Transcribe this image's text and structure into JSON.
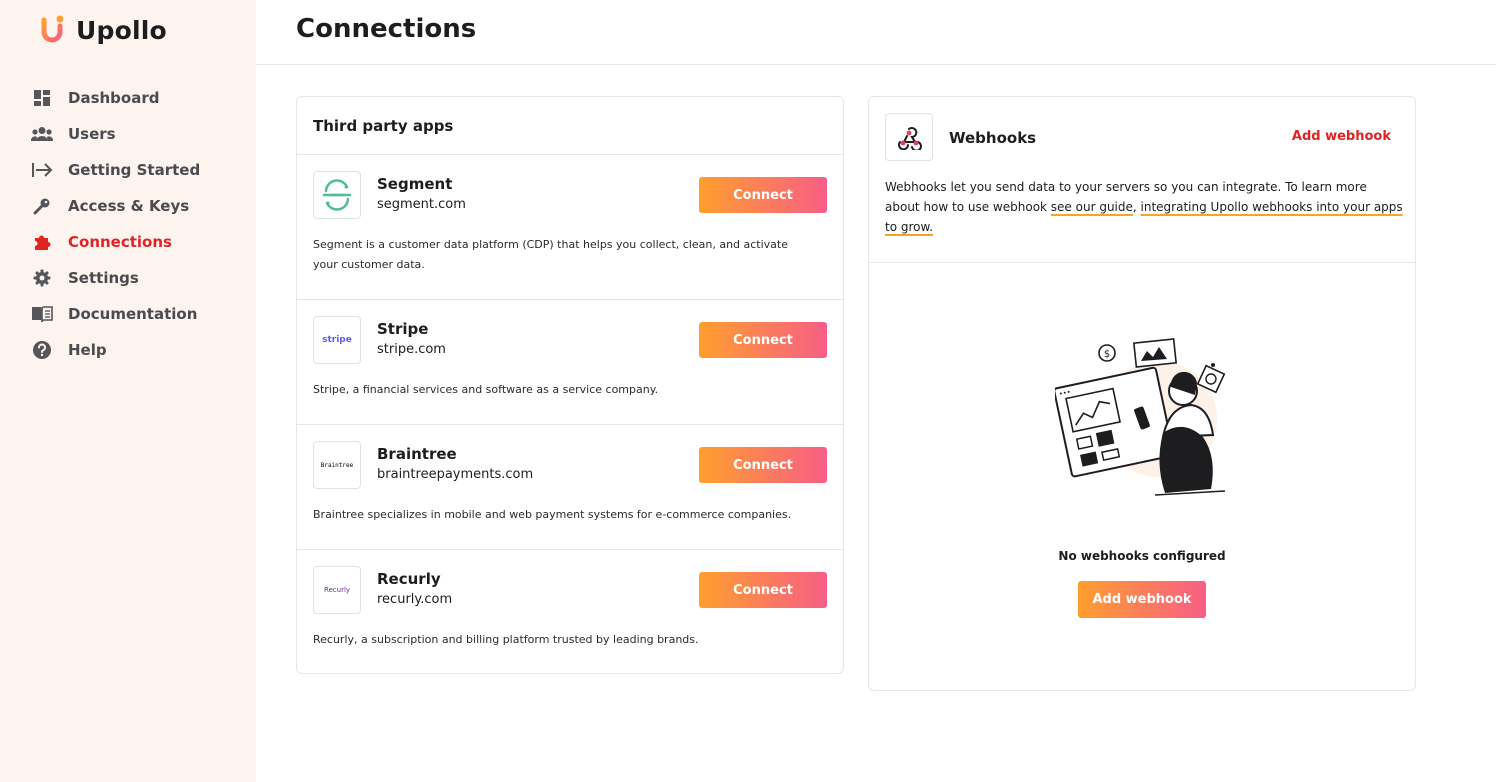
{
  "brand": {
    "name": "Upollo",
    "accent": "#e02424",
    "gradient_start": "#ff9f2e",
    "gradient_end": "#f75e86"
  },
  "sidebar": {
    "items": [
      {
        "label": "Dashboard",
        "icon": "dashboard-icon",
        "active": false
      },
      {
        "label": "Users",
        "icon": "users-icon",
        "active": false
      },
      {
        "label": "Getting Started",
        "icon": "arrow-right-bar-icon",
        "active": false
      },
      {
        "label": "Access & Keys",
        "icon": "key-icon",
        "active": false
      },
      {
        "label": "Connections",
        "icon": "puzzle-icon",
        "active": true
      },
      {
        "label": "Settings",
        "icon": "gear-icon",
        "active": false
      },
      {
        "label": "Documentation",
        "icon": "book-icon",
        "active": false
      },
      {
        "label": "Help",
        "icon": "help-icon",
        "active": false
      }
    ]
  },
  "header": {
    "title": "Connections"
  },
  "third_party": {
    "title": "Third party apps",
    "apps": [
      {
        "name": "Segment",
        "domain": "segment.com",
        "button": "Connect",
        "logo": "segment-logo",
        "description": "Segment is a customer data platform (CDP) that helps you collect, clean, and activate your customer data."
      },
      {
        "name": "Stripe",
        "domain": "stripe.com",
        "button": "Connect",
        "logo": "stripe-logo",
        "logo_text": "stripe",
        "description": "Stripe, a financial services and software as a service company."
      },
      {
        "name": "Braintree",
        "domain": "braintreepayments.com",
        "button": "Connect",
        "logo": "braintree-logo",
        "logo_text": "Braintree",
        "description": "Braintree specializes in mobile and web payment systems for e-commerce companies."
      },
      {
        "name": "Recurly",
        "domain": "recurly.com",
        "button": "Connect",
        "logo": "recurly-logo",
        "logo_text": "Recurly",
        "description": "Recurly, a subscription and billing platform trusted by leading brands."
      }
    ]
  },
  "webhooks": {
    "title": "Webhooks",
    "add_link": "Add webhook",
    "desc_before": "Webhooks let you send data to your servers so you can integrate. To learn more about how to use webhook ",
    "link1": "see our guide",
    "desc_sep": ", ",
    "link2": "integrating Upollo webhooks into your apps to grow.",
    "empty_text": "No webhooks configured",
    "empty_button": "Add webhook"
  }
}
